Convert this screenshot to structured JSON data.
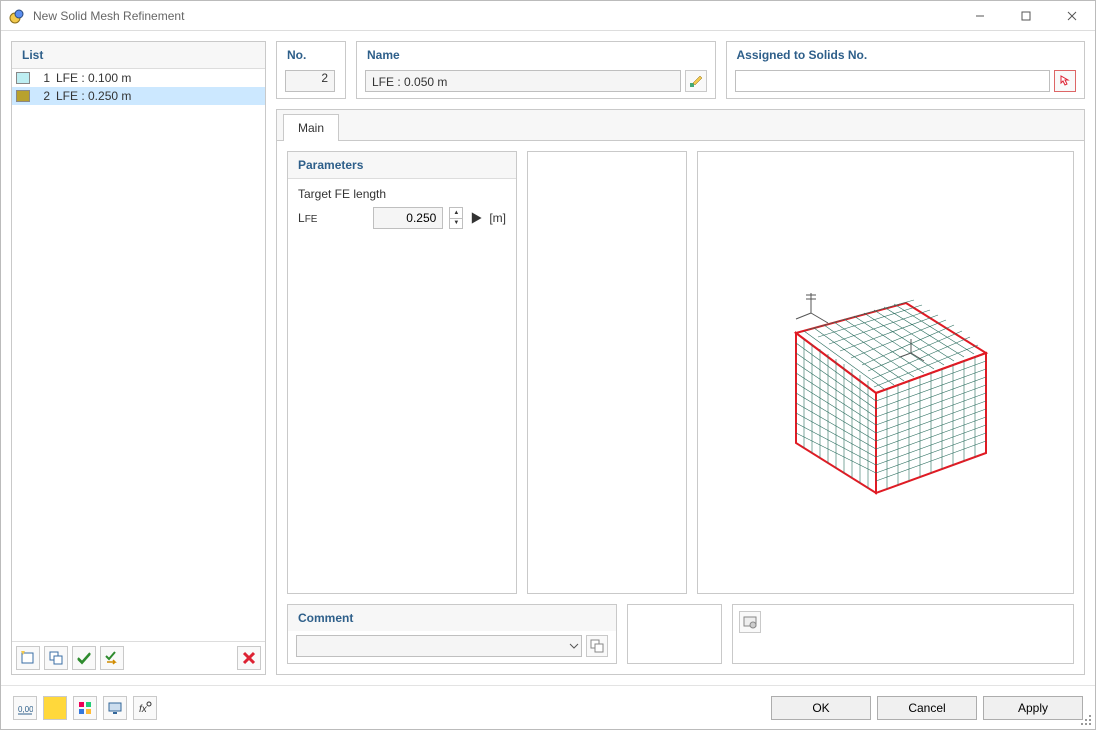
{
  "title": "New Solid Mesh Refinement",
  "list": {
    "header": "List",
    "items": [
      {
        "num": "1",
        "label": "LFE : 0.100 m",
        "color": "#bdeef2",
        "selected": false
      },
      {
        "num": "2",
        "label": "LFE : 0.250 m",
        "color": "#b8a12e",
        "selected": true
      }
    ]
  },
  "fields": {
    "no_label": "No.",
    "no_value": "2",
    "name_label": "Name",
    "name_value": "LFE : 0.050 m",
    "assigned_label": "Assigned to Solids No.",
    "assigned_value": ""
  },
  "tabs": {
    "main": "Main"
  },
  "parameters": {
    "header": "Parameters",
    "target_label": "Target FE length",
    "lfe_symbol": "LFE",
    "lfe_value": "0.250",
    "unit": "[m]"
  },
  "comment": {
    "header": "Comment",
    "value": ""
  },
  "buttons": {
    "ok": "OK",
    "cancel": "Cancel",
    "apply": "Apply"
  },
  "icons": {
    "new": "new-icon",
    "copy": "copy-icon",
    "checkall": "check-all-icon",
    "checkreset": "check-reset-icon",
    "delete": "delete-icon",
    "edit_name": "edit-name-icon",
    "pick": "pick-solids-icon",
    "comment_lib": "comment-library-icon",
    "preview_settings": "preview-settings-icon",
    "units": "units-icon",
    "color": "color-icon",
    "tags": "tags-icon",
    "screen": "screen-icon",
    "fx": "fx-icon"
  }
}
